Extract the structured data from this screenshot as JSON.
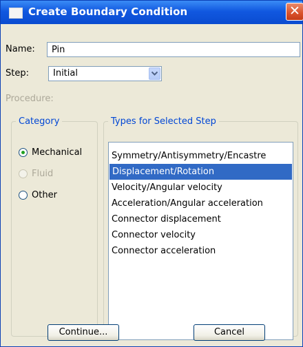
{
  "window": {
    "title": "Create Boundary Condition",
    "close_glyph": "✕"
  },
  "form": {
    "name_label": "Name:",
    "name_value": "Pin",
    "step_label": "Step:",
    "step_value": "Initial",
    "procedure_label": "Procedure:"
  },
  "category": {
    "legend": "Category",
    "options": [
      {
        "label": "Mechanical",
        "checked": true,
        "enabled": true
      },
      {
        "label": "Fluid",
        "checked": false,
        "enabled": false
      },
      {
        "label": "Other",
        "checked": false,
        "enabled": true
      }
    ]
  },
  "types": {
    "legend": "Types for Selected Step",
    "items": [
      "Symmetry/Antisymmetry/Encastre",
      "Displacement/Rotation",
      "Velocity/Angular velocity",
      "Acceleration/Angular acceleration",
      "Connector displacement",
      "Connector velocity",
      "Connector acceleration"
    ],
    "selected_index": 1
  },
  "buttons": {
    "continue_label": "Continue...",
    "cancel_label": "Cancel"
  },
  "colors": {
    "titlebar": "#0a4bd0",
    "selection": "#316ac5",
    "legend": "#0046d5",
    "radio_dot": "#21a121",
    "close_button": "#d9512b"
  }
}
